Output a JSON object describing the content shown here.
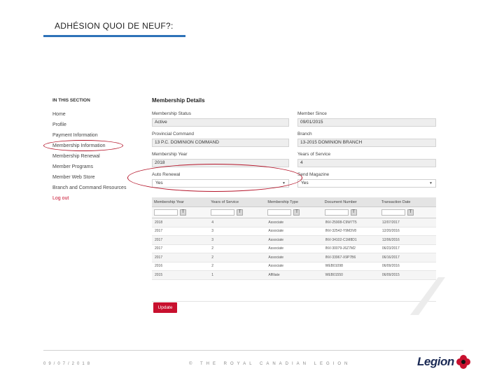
{
  "slide": {
    "title": "ADHÉSION QUOI DE NEUF?:"
  },
  "sidebar": {
    "section_title": "IN THIS SECTION",
    "items": [
      {
        "label": "Home"
      },
      {
        "label": "Profile"
      },
      {
        "label": "Payment Information"
      },
      {
        "label": "Membership Information"
      },
      {
        "label": "Membership Renewal"
      },
      {
        "label": "Member Programs"
      },
      {
        "label": "Member Web Store"
      },
      {
        "label": "Branch and Command Resources"
      },
      {
        "label": "Log out"
      }
    ]
  },
  "details": {
    "title": "Membership Details",
    "membership_status": {
      "label": "Membership Status",
      "value": "Active"
    },
    "member_since": {
      "label": "Member Since",
      "value": "09/01/2015"
    },
    "provincial_command": {
      "label": "Provincial Command",
      "value": "13 P.C. DOMINION COMMAND"
    },
    "branch": {
      "label": "Branch",
      "value": "13-2015 DOMINION BRANCH"
    },
    "membership_year": {
      "label": "Membership Year",
      "value": "2018"
    },
    "years_of_service": {
      "label": "Years of Service",
      "value": "4"
    },
    "auto_renewal": {
      "label": "Auto Renewal",
      "value": "Yes"
    },
    "send_magazine": {
      "label": "Send Magazine",
      "value": "Yes"
    }
  },
  "grid": {
    "filter_icon": "T",
    "columns": [
      "Membership Year",
      "Years of Service",
      "Membership Type",
      "Document Number",
      "Transaction Date"
    ],
    "rows": [
      [
        "2018",
        "4",
        "Associate",
        "INV-25908-C9W7T5",
        "12/07/2017"
      ],
      [
        "2017",
        "3",
        "Associate",
        "INV-32542-Y9M3V8",
        "12/20/2016"
      ],
      [
        "2017",
        "3",
        "Associate",
        "INV-34102-C1M8D1",
        "12/06/2016"
      ],
      [
        "2017",
        "2",
        "Associate",
        "INV-30079-J6Z7M2",
        "06/23/2017"
      ],
      [
        "2017",
        "2",
        "Associate",
        "INV-33967-X9P7B6",
        "06/16/2017"
      ],
      [
        "2016",
        "2",
        "Associate",
        "WEB01098",
        "06/09/2016"
      ],
      [
        "2015",
        "1",
        "Affiliate",
        "WEB01550",
        "06/09/2015"
      ]
    ]
  },
  "actions": {
    "update_label": "Update"
  },
  "footer": {
    "date": "09/07/2018",
    "copyright": "© THE ROYAL CANADIAN LEGION",
    "logo_text": "Legion"
  },
  "colors": {
    "accent_blue": "#2e72b8",
    "legion_red": "#c8102e",
    "annotation_red": "#b5152a",
    "logo_navy": "#1b2a55"
  }
}
